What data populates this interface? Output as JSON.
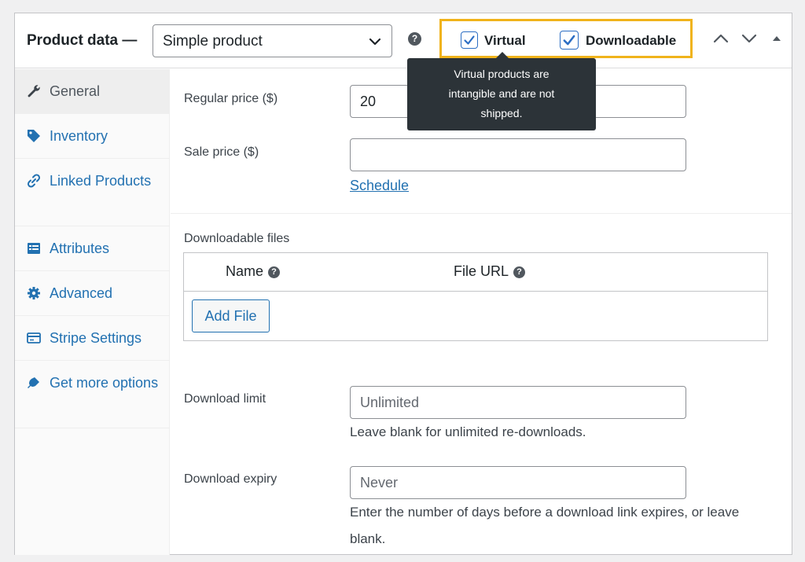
{
  "header": {
    "title": "Product data —",
    "product_type": "Simple product",
    "help_icon": "?",
    "virtual": {
      "label": "Virtual",
      "checked": true
    },
    "downloadable": {
      "label": "Downloadable",
      "checked": true
    }
  },
  "tooltip": {
    "lines": [
      "Virtual products are",
      "intangible and are not",
      "shipped."
    ]
  },
  "tabs": [
    {
      "label": "General",
      "icon": "wrench-icon",
      "active": true
    },
    {
      "label": "Inventory",
      "icon": "tag-icon"
    },
    {
      "label": "Linked Products",
      "icon": "link-icon"
    },
    {
      "label": "Attributes",
      "icon": "list-view-icon"
    },
    {
      "label": "Advanced",
      "icon": "gear-icon"
    },
    {
      "label": "Stripe Settings",
      "icon": "card-icon"
    },
    {
      "label": "Get more options",
      "icon": "plugin-icon"
    }
  ],
  "general": {
    "regular_price_label": "Regular price ($)",
    "regular_price_value": "20",
    "sale_price_label": "Sale price ($)",
    "sale_price_value": "",
    "schedule_link": "Schedule",
    "downloadable_files_label": "Downloadable files",
    "col_name": "Name",
    "col_file_url": "File URL",
    "add_file_button": "Add File",
    "download_limit_label": "Download limit",
    "download_limit_placeholder": "Unlimited",
    "download_limit_desc": "Leave blank for unlimited re-downloads.",
    "download_expiry_label": "Download expiry",
    "download_expiry_placeholder": "Never",
    "download_expiry_desc": "Enter the number of days before a download link expires, or leave blank."
  },
  "colors": {
    "accent": "#2271b1",
    "highlight": "#f0b31b",
    "tooltip_bg": "#2c3338"
  }
}
